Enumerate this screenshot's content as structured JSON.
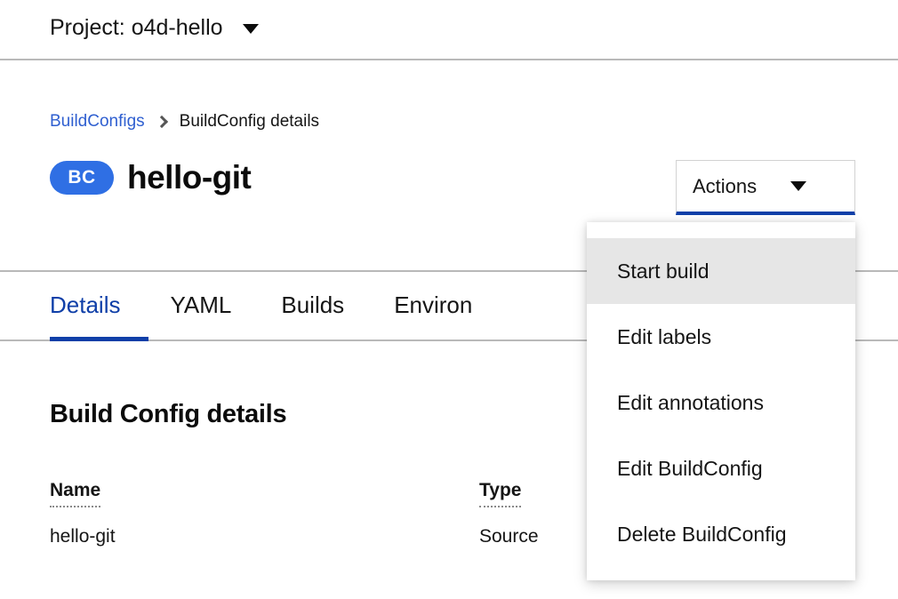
{
  "project_bar": {
    "label": "Project: o4d-hello",
    "caret_icon": "chevron-down-icon"
  },
  "breadcrumb": {
    "parent": "BuildConfigs",
    "separator_icon": "chevron-right-icon",
    "current": "BuildConfig details"
  },
  "header": {
    "badge": "BC",
    "title": "hello-git",
    "badge_color": "#2f6fe4"
  },
  "actions": {
    "button_label": "Actions",
    "caret_icon": "chevron-down-icon",
    "menu": [
      {
        "label": "Start build",
        "highlighted": true
      },
      {
        "label": "Edit labels",
        "highlighted": false
      },
      {
        "label": "Edit annotations",
        "highlighted": false
      },
      {
        "label": "Edit BuildConfig",
        "highlighted": false
      },
      {
        "label": "Delete BuildConfig",
        "highlighted": false
      }
    ]
  },
  "tabs": [
    {
      "label": "Details",
      "active": true
    },
    {
      "label": "YAML",
      "active": false
    },
    {
      "label": "Builds",
      "active": false
    },
    {
      "label": "Environ",
      "active": false
    }
  ],
  "details": {
    "heading": "Build Config details",
    "fields": [
      {
        "label": "Name",
        "value": "hello-git"
      },
      {
        "label": "Type",
        "value": "Source"
      }
    ]
  },
  "colors": {
    "accent_blue": "#0f3fa8",
    "link_blue": "#2f5fd0",
    "badge_blue": "#2f6fe4",
    "highlight_gray": "#e6e6e6",
    "border_gray": "#b9b9b9"
  }
}
